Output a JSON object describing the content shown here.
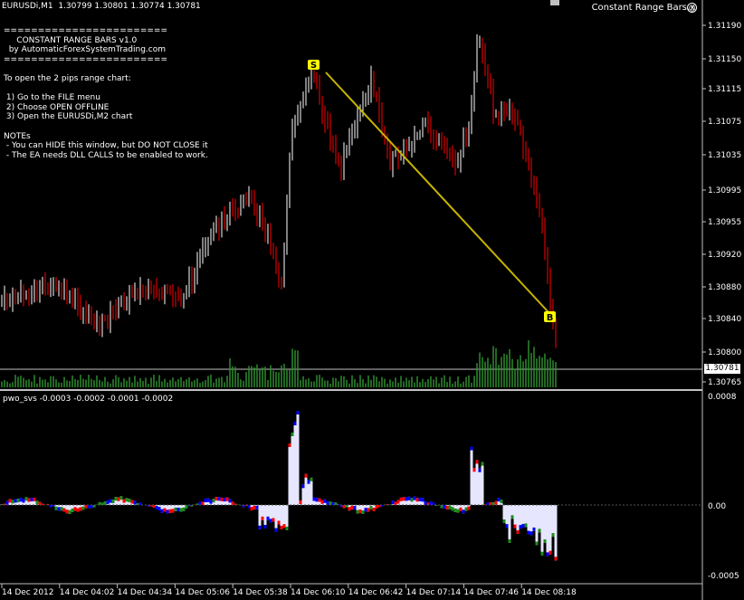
{
  "header": {
    "title": "EURUSDi,M1  1.30799 1.30801 1.30774 1.30781",
    "ea_label": "Constant Range Bars.x",
    "smiley": "☺"
  },
  "info_panel": {
    "lines": [
      "========================",
      "     CONSTANT RANGE BARS v1.0",
      "  by AutomaticForexSystemTrading.com",
      "========================",
      "",
      "To open the 2 pips range chart:",
      "",
      " 1) Go to the FILE menu",
      " 2) Choose OPEN OFFLINE",
      " 3) Open the EURUSDi,M2 chart",
      "",
      "NOTEs",
      " - You can HIDE this window, but DO NOT CLOSE it",
      " - The EA needs DLL CALLS to be enabled to work."
    ]
  },
  "price_axis": {
    "labels": [
      "1.31190",
      "1.31150",
      "1.31115",
      "1.31075",
      "1.31035",
      "1.30995",
      "1.30955",
      "1.30920",
      "1.30880",
      "1.30840",
      "1.30800",
      "1.30765"
    ],
    "current_price": "1.30781"
  },
  "markers": {
    "sell": "S",
    "buy": "B"
  },
  "indicator": {
    "label": "pwo_svs -0.0003 -0.0002 -0.0001 -0.0002",
    "axis_labels": [
      "0.0008",
      "0.00",
      "-0.0005"
    ]
  },
  "time_axis": {
    "labels": [
      "14 Dec 2012",
      "14 Dec 04:02",
      "14 Dec 04:34",
      "14 Dec 05:06",
      "14 Dec 05:38",
      "14 Dec 06:10",
      "14 Dec 06:42",
      "14 Dec 07:14",
      "14 Dec 07:46",
      "14 Dec 08:18"
    ]
  },
  "colors": {
    "background": "#000000",
    "bull": "#ffffff",
    "bear": "#ff0000",
    "volume": "#2e8b2e",
    "trendline": "#c8b400",
    "marker": "#ffff00",
    "osc_fill": "#e6e6ff",
    "osc_blue": "#0000ff",
    "osc_green": "#1a8c1a",
    "osc_red": "#ff0000"
  }
}
